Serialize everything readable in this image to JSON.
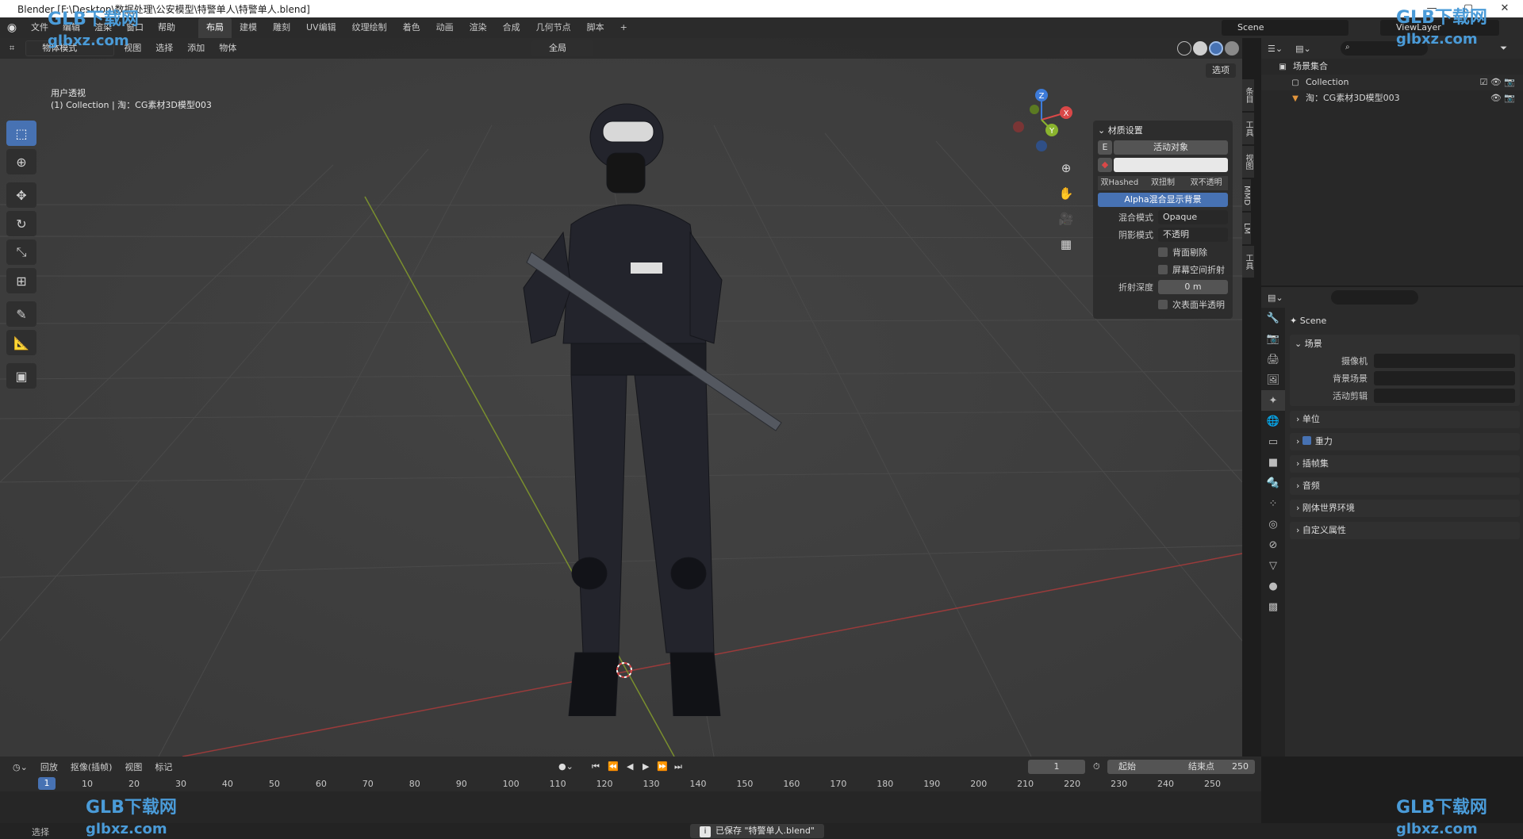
{
  "window": {
    "title": "Blender [F:\\Desktop\\数据处理\\公安模型\\特警单人\\特警单人.blend]",
    "controls": [
      "—",
      "▢",
      "✕"
    ]
  },
  "menubar": {
    "items": [
      "文件",
      "编辑",
      "渲染",
      "窗口",
      "帮助"
    ],
    "workspaces": [
      "布局",
      "建模",
      "雕刻",
      "UV编辑",
      "纹理绘制",
      "着色",
      "动画",
      "渲染",
      "合成",
      "几何节点",
      "脚本"
    ],
    "active_workspace": "布局",
    "add_tab": "+",
    "scene": "Scene",
    "view_layer": "ViewLayer"
  },
  "viewport_header": {
    "mode": "物体模式",
    "menus": [
      "视图",
      "选择",
      "添加",
      "物体"
    ],
    "pivot": "全局",
    "options": "选项"
  },
  "viewport_info": {
    "view_name": "用户透视",
    "collection_line": "(1) Collection | 淘：CG素材3D模型003"
  },
  "gizmo": {
    "x": "X",
    "y": "Y",
    "z": "Z",
    "colors": {
      "x": "#d94848",
      "y": "#8ab42e",
      "z": "#3d7bd9"
    }
  },
  "material_panel": {
    "title": "材质设置",
    "active_object": "活动对象",
    "key_label": "E",
    "blend_toggles": [
      "双Hashed",
      "双扭制",
      "双不透明"
    ],
    "alpha_button": "Alpha混合显示背景",
    "blend_mode_label": "混合模式",
    "blend_mode_value": "Opaque",
    "shadow_mode_label": "阴影模式",
    "shadow_mode_value": "不透明",
    "backface": "背面剔除",
    "screen_refraction": "屏幕空间折射",
    "refraction_depth_label": "折射深度",
    "refraction_depth_value": "0 m",
    "subsurface": "次表面半透明"
  },
  "side_tabs": [
    "条目",
    "工具",
    "视图",
    "MMD",
    "LM",
    "工具"
  ],
  "outliner": {
    "root": "场景集合",
    "rows": [
      {
        "name": "Collection"
      },
      {
        "name": "淘：CG素材3D模型003"
      }
    ]
  },
  "properties": {
    "breadcrumb": "Scene",
    "section": "场景",
    "fields": [
      {
        "label": "摄像机",
        "value": ""
      },
      {
        "label": "背景场景",
        "value": ""
      },
      {
        "label": "活动剪辑",
        "value": ""
      }
    ],
    "collapsed": [
      "单位",
      "重力",
      "插帧集",
      "音频",
      "刚体世界环境",
      "自定义属性"
    ],
    "gravity_checked": true
  },
  "timeline": {
    "menus": [
      "回放",
      "抠像(插帧)",
      "视图",
      "标记"
    ],
    "current_frame": "1",
    "start_label": "起始",
    "start_value": "1",
    "end_label": "结束点",
    "end_value": "250",
    "ruler": [
      "1",
      "10",
      "20",
      "30",
      "40",
      "50",
      "60",
      "70",
      "80",
      "90",
      "100",
      "110",
      "120",
      "130",
      "140",
      "150",
      "160",
      "170",
      "180",
      "190",
      "200",
      "210",
      "220",
      "230",
      "240",
      "250"
    ],
    "transport": [
      "⏮",
      "⏪",
      "◀",
      "▶",
      "⏩",
      "⏭"
    ]
  },
  "statusbar": {
    "message": "已保存 \"特警单人.blend\"",
    "left_label": "选择"
  },
  "watermark": {
    "brand": "GLB下载网",
    "site": "glbxz.com"
  }
}
